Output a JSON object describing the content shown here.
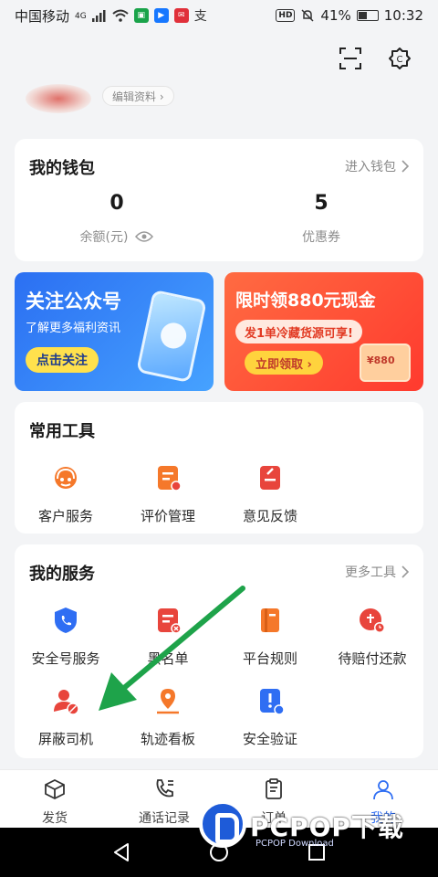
{
  "status_bar": {
    "carrier": "中国移动",
    "network": "4G",
    "hd": "HD",
    "battery": "41%",
    "time": "10:32"
  },
  "header": {
    "scan_icon": "scan-icon",
    "settings_icon": "settings-icon"
  },
  "profile": {
    "edit_label": "编辑资料 ›"
  },
  "wallet": {
    "title": "我的钱包",
    "link": "进入钱包",
    "balance_value": "0",
    "balance_label": "余额(元)",
    "coupons_value": "5",
    "coupons_label": "优惠券"
  },
  "banners": {
    "left": {
      "title": "关注公众号",
      "subtitle": "了解更多福利资讯",
      "button": "点击关注"
    },
    "right": {
      "title": "限时领880元现金",
      "subtitle": "发1单冷藏货源可享!",
      "button": "立即领取 ›",
      "badge": "¥880"
    }
  },
  "tools": {
    "title": "常用工具",
    "items": [
      {
        "label": "客户服务"
      },
      {
        "label": "评价管理"
      },
      {
        "label": "意见反馈"
      }
    ]
  },
  "services": {
    "title": "我的服务",
    "link": "更多工具",
    "items": [
      {
        "label": "安全号服务"
      },
      {
        "label": "黑名单"
      },
      {
        "label": "平台规则"
      },
      {
        "label": "待赔付还款"
      },
      {
        "label": "屏蔽司机"
      },
      {
        "label": "轨迹看板"
      },
      {
        "label": "安全验证"
      }
    ]
  },
  "tabs": [
    {
      "label": "发货"
    },
    {
      "label": "通话记录"
    },
    {
      "label": "订单"
    },
    {
      "label": "我的"
    }
  ],
  "watermark": {
    "text": "PCPOP下载",
    "sub": "PCPOP Download"
  },
  "colors": {
    "accent_blue": "#2f6ef3",
    "orange": "#f5782a",
    "red": "#e8453c",
    "arrow_green": "#1ea34a"
  }
}
